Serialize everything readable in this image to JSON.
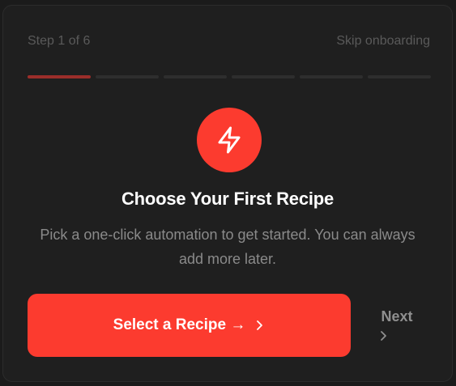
{
  "onboarding": {
    "step_label": "Step 1 of 6",
    "skip_label": "Skip onboarding",
    "progress": {
      "current_step": 1,
      "total_steps": 6
    },
    "icon": "lightning-bolt-icon",
    "title": "Choose Your First Recipe",
    "description": "Pick a one-click automation to get started. You can always add more later.",
    "primary_button_label": "Select a Recipe →",
    "next_button_label": "Next"
  },
  "colors": {
    "accent": "#fc3b2f",
    "progress_active": "#9b2e2a",
    "progress_inactive": "#2e2e2e",
    "card_background": "#1f1f1f"
  }
}
